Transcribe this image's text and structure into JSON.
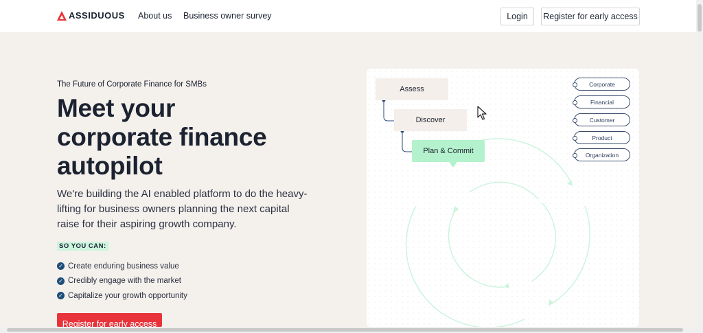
{
  "nav": {
    "brand": "ASSIDUOUS",
    "links": [
      "About us",
      "Business owner survey"
    ],
    "login_label": "Login",
    "register_label": "Register for early access"
  },
  "hero": {
    "tagline": "The Future of Corporate Finance for SMBs",
    "headline": [
      "Meet your",
      "corporate finance",
      "autopilot"
    ],
    "subtext": "We're building the AI enabled platform to do the heavy-lifting for business owners planning the next capital raise for their aspiring growth company.",
    "badge": "SO YOU CAN:",
    "benefits": [
      "Create enduring business value",
      "Credibly engage with the market",
      "Capitalize your growth opportunity"
    ],
    "cta_label": "Register for early access"
  },
  "diagram": {
    "steps": [
      "Assess",
      "Discover",
      "Plan & Commit"
    ],
    "categories": [
      "Corporate",
      "Financial",
      "Customer",
      "Product",
      "Organization"
    ]
  },
  "colors": {
    "brand_red": "#e8333a",
    "accent_green": "#b4f2cd",
    "navy": "#1f4e79",
    "page_bg": "#f4f0ec"
  }
}
